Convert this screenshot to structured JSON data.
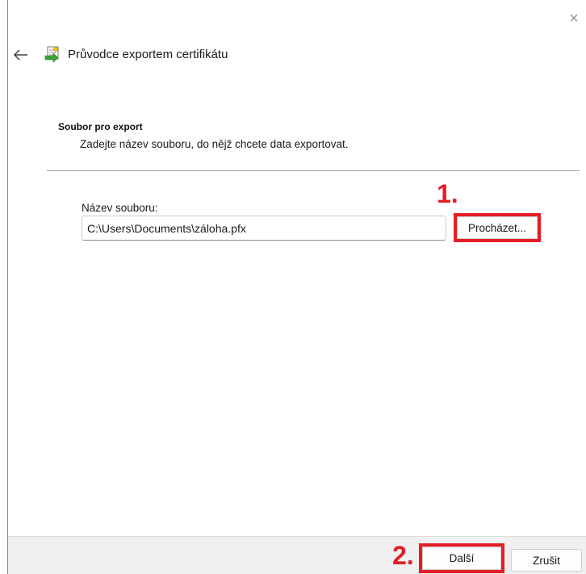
{
  "window": {
    "title": "Průvodce exportem certifikátu",
    "close_glyph": "×",
    "close_icon": "close-icon",
    "back_icon": "arrow-left-icon",
    "wizard_icon": "certificate-wizard-icon"
  },
  "section": {
    "heading": "Soubor pro export",
    "description": "Zadejte název souboru, do nějž chcete data exportovat."
  },
  "file": {
    "label": "Název souboru:",
    "value": "C:\\Users\\Documents\\záloha.pfx",
    "browse_label": "Procházet..."
  },
  "footer": {
    "next_label": "Další",
    "cancel_label": "Zrušit"
  },
  "annotations": {
    "step1": "1.",
    "step2": "2.",
    "highlight_color": "#e41e26"
  }
}
